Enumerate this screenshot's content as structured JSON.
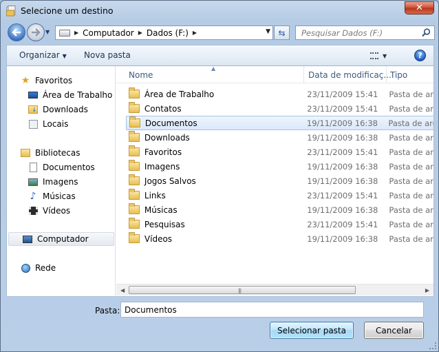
{
  "window": {
    "title": "Selecione um destino",
    "close_glyph": "✕"
  },
  "address_bar": {
    "crumbs": [
      "Computador",
      "Dados (F:)"
    ],
    "search_placeholder": "Pesquisar Dados (F:)"
  },
  "toolbar": {
    "organize_label": "Organizar",
    "new_folder_label": "Nova pasta",
    "help_glyph": "?"
  },
  "nav_pane": {
    "favorites": {
      "label": "Favoritos",
      "items": [
        "Área de Trabalho",
        "Downloads",
        "Locais"
      ]
    },
    "libraries": {
      "label": "Bibliotecas",
      "items": [
        "Documentos",
        "Imagens",
        "Músicas",
        "Vídeos"
      ]
    },
    "computer": "Computador",
    "network": "Rede"
  },
  "columns": {
    "name": "Nome",
    "date": "Data de modificaç...",
    "type": "Tipo"
  },
  "files": [
    {
      "name": "Área de Trabalho",
      "date": "23/11/2009 15:41",
      "type": "Pasta de arq"
    },
    {
      "name": "Contatos",
      "date": "23/11/2009 15:41",
      "type": "Pasta de arq"
    },
    {
      "name": "Documentos",
      "date": "19/11/2009 16:38",
      "type": "Pasta de arq"
    },
    {
      "name": "Downloads",
      "date": "19/11/2009 16:38",
      "type": "Pasta de arq"
    },
    {
      "name": "Favoritos",
      "date": "23/11/2009 15:41",
      "type": "Pasta de arq"
    },
    {
      "name": "Imagens",
      "date": "19/11/2009 16:38",
      "type": "Pasta de arq"
    },
    {
      "name": "Jogos Salvos",
      "date": "19/11/2009 16:38",
      "type": "Pasta de arq"
    },
    {
      "name": "Links",
      "date": "23/11/2009 15:41",
      "type": "Pasta de arq"
    },
    {
      "name": "Músicas",
      "date": "19/11/2009 16:38",
      "type": "Pasta de arq"
    },
    {
      "name": "Pesquisas",
      "date": "23/11/2009 15:41",
      "type": "Pasta de arq"
    },
    {
      "name": "Vídeos",
      "date": "19/11/2009 16:38",
      "type": "Pasta de arq"
    }
  ],
  "selected_file_index": 2,
  "footer": {
    "folder_label": "Pasta:",
    "folder_value": "Documentos",
    "select_button": "Selecionar pasta",
    "cancel_button": "Cancelar"
  },
  "colors": {
    "selection": "#d9e8f9",
    "window_frame": "#b9cfe8",
    "close_button": "#cc4b30"
  }
}
